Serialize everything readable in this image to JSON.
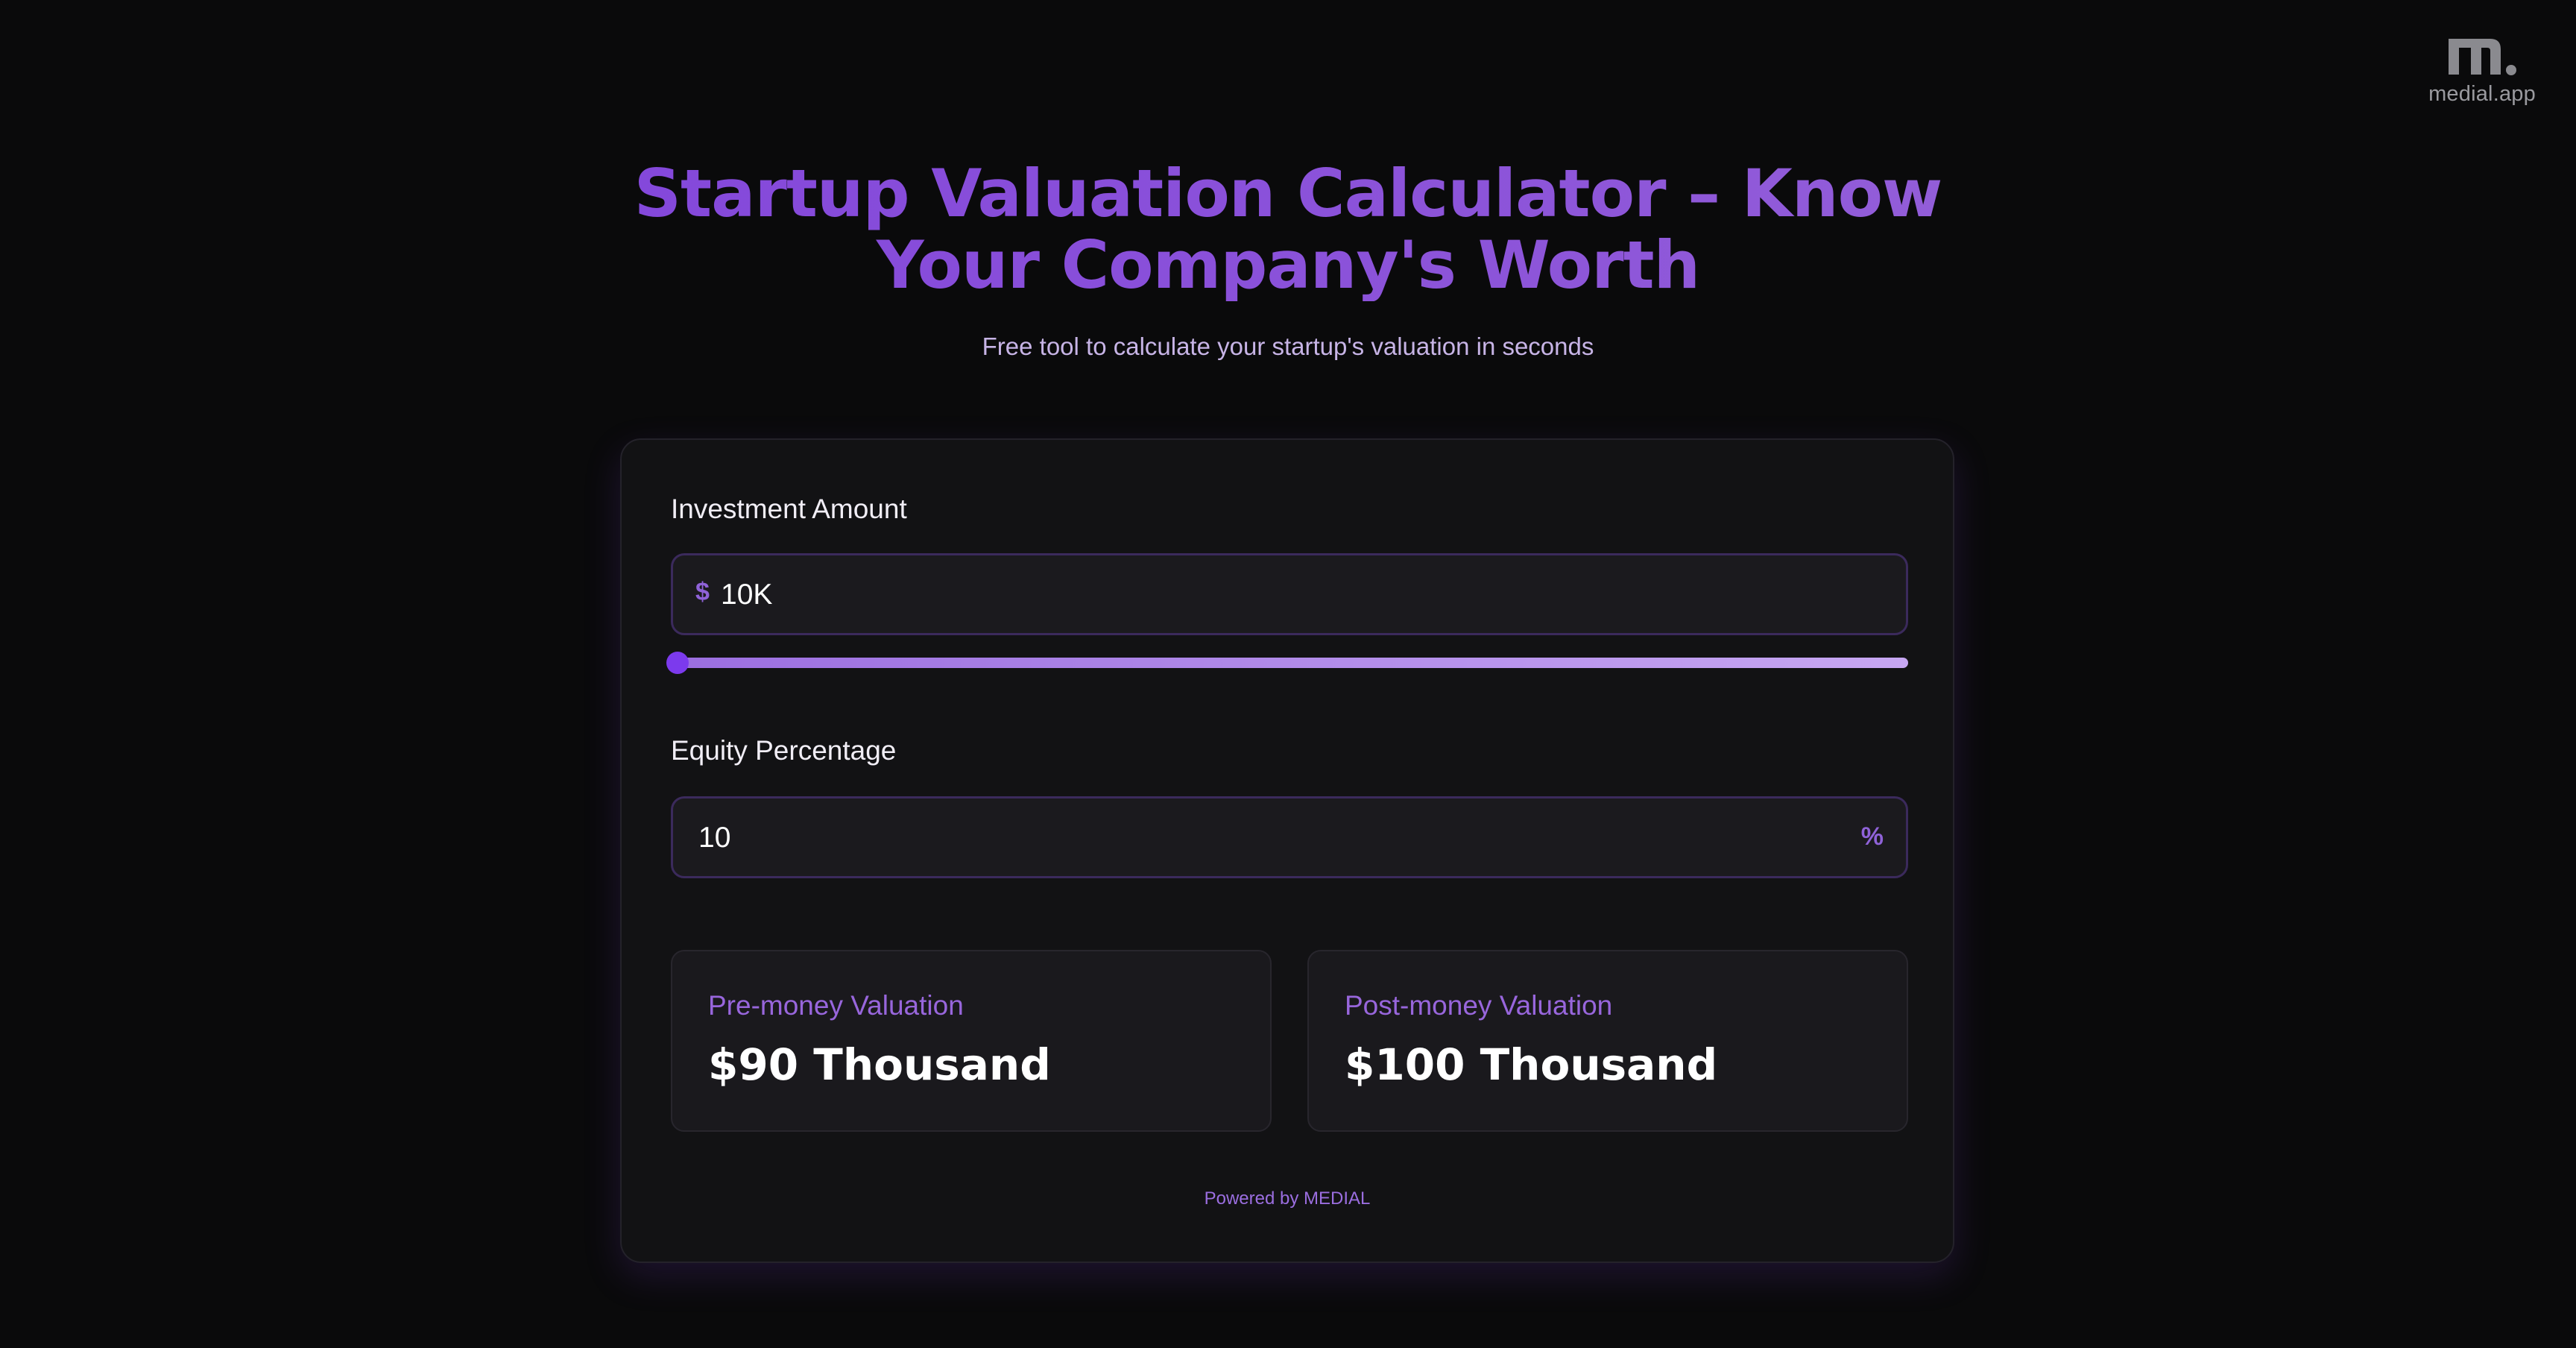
{
  "brand": {
    "logo_icon": "medial-logo-icon",
    "text": "medial.app"
  },
  "header": {
    "title_line1": "Startup Valuation Calculator – Know",
    "title_line2": "Your Company's Worth",
    "subtitle": "Free tool to calculate your startup's valuation in seconds"
  },
  "form": {
    "investment": {
      "label": "Investment Amount",
      "prefix": "$",
      "value": "10K",
      "slider_fraction": 0.0
    },
    "equity": {
      "label": "Equity Percentage",
      "value": "10",
      "suffix": "%"
    }
  },
  "results": {
    "pre_money": {
      "label": "Pre-money Valuation",
      "value": "$90 Thousand"
    },
    "post_money": {
      "label": "Post-money Valuation",
      "value": "$100 Thousand"
    }
  },
  "footer": {
    "powered_by": "Powered by MEDIAL"
  },
  "colors": {
    "background": "#0a0a0b",
    "accent": "#7c3aed",
    "title_gradient_start": "#7e3fdc",
    "title_gradient_end": "#9b6ad8"
  }
}
